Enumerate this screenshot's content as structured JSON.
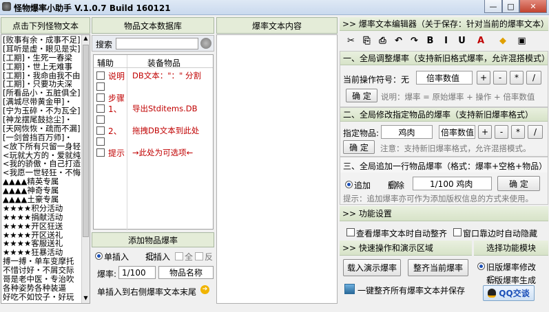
{
  "app": {
    "title": "怪物爆率小助手 V.1.0.7 Build 160121",
    "min": "—",
    "max": "□",
    "close": "✕"
  },
  "left": {
    "header": "点击下列怪物文本",
    "items": [
      "[败事有余・成事不足]",
      "[耳听是虚・眼见是实]",
      "[工期]・生死一春梁",
      "[工期]・世上无难事",
      "[工期]・我命由我不由",
      "[工期]・只要功夫深",
      "[所看品小・五脏俱全]",
      "[满城尽带黄金甲]・",
      "[宁为玉碎・不为瓦全]",
      "[神龙摆尾鼓捻尘]・",
      "[天网恢恢・疏而不漏]",
      "[一剑曾挡百万师]・",
      "<放下所有只留一身轻>",
      "<玩就大方的・爱就纯>",
      "<我的骄傲・自己打造>",
      "<我愿一世轻狂・不悔>",
      "▲▲▲▲精英专属",
      "▲▲▲▲神奇专属",
      "▲▲▲▲土豪专属",
      "★★★★积分活动",
      "★★★★捐献活动",
      "★★★★开区狂送",
      "★★★★开区送礼",
      "★★★★客服送礼",
      "★★★★狂暴活动",
      "搏一搏・单车变摩托",
      "不惜讨好・不屑交际",
      "哥是老中医・专治吹",
      "各种姿势各种装逼",
      "好吃不如饺子・好玩"
    ]
  },
  "db": {
    "header": "物品文本数据库",
    "search_label": "搜索",
    "search_value": "",
    "col_aux": "辅助",
    "col_item": "装备物品",
    "rows": [
      {
        "checked": false,
        "aux": "说明",
        "item": "DB文本：\"：\" 分割"
      },
      {
        "checked": false,
        "aux": "",
        "item": ""
      },
      {
        "checked": false,
        "aux": "步骤",
        "item": ""
      },
      {
        "checked": false,
        "aux": "1、",
        "item": "导出Stditems.DB"
      },
      {
        "checked": false,
        "aux": "",
        "item": ""
      },
      {
        "checked": false,
        "aux": "2、",
        "item": "拖拽DB文本到此处"
      },
      {
        "checked": false,
        "aux": "",
        "item": ""
      },
      {
        "checked": false,
        "aux": "提示",
        "item": "→此处为可选项←"
      }
    ],
    "add_header": "添加物品爆率",
    "radio_single": "单插入",
    "radio_batch": "批插入",
    "cb_all": "全",
    "cb_reverse": "反",
    "rate_label": "爆率:",
    "rate_value": "1/100",
    "item_name": "物品名称",
    "append_text": "单插入到右侧爆率文本末尾"
  },
  "content": {
    "header": "爆率文本内容"
  },
  "editor": {
    "header": ">> 爆率文本编辑器（关于保存：针对当前的爆率文本）",
    "toolbar": [
      "✂",
      "⎘",
      "⎙",
      "↶",
      "↷",
      "B",
      "I",
      "U",
      "A",
      "◆",
      "▣"
    ],
    "s1": {
      "title": "一、全局调整爆率（支持新旧格式爆率，允许混搭模式）",
      "op_label": "当前操作符号：无",
      "op_value": "倍率数值",
      "ops": [
        "+",
        "-",
        "*",
        "/"
      ],
      "confirm": "确 定",
      "hint": "说明：爆率 = 原始爆率 + 操作 + 倍率数值"
    },
    "s2": {
      "title": "二、全局修改指定物品的爆率（支持新旧爆率格式）",
      "item_label": "指定物品:",
      "item_value": "鸡肉",
      "rate_value": "倍率数值",
      "ops": [
        "+",
        "-",
        "*",
        "/"
      ],
      "confirm": "确 定",
      "hint": "注意：支持新旧爆率格式，允许混搭模式。"
    },
    "s3": {
      "title": "三、全局追加一行物品爆率（格式：爆率+空格+物品）",
      "radio_add": "追加",
      "radio_del": "删除",
      "value": "1/100 鸡肉",
      "confirm": "确 定",
      "hint": "提示：追加爆率亦可作为添加版权信息的方式来使用。"
    },
    "features": {
      "header": ">> 功能设置",
      "cb1": "查看爆率文本时自动整齐",
      "cb2": "窗口靠边时自动隐藏"
    },
    "ops": {
      "header": ">> 快速操作和演示区域",
      "btn1": "载入演示爆率",
      "btn2": "整齐当前爆率",
      "save_all": "一键整齐所有爆率文本并保存"
    },
    "modules": {
      "header": "选择功能模块",
      "r1": "旧版爆率修改",
      "r2": "新版爆率生成",
      "qq": "QQ交谈"
    }
  },
  "colors": {
    "red": "#c00000",
    "green_hdr": "#e4ecd8",
    "accent": "#1a4fb8"
  }
}
